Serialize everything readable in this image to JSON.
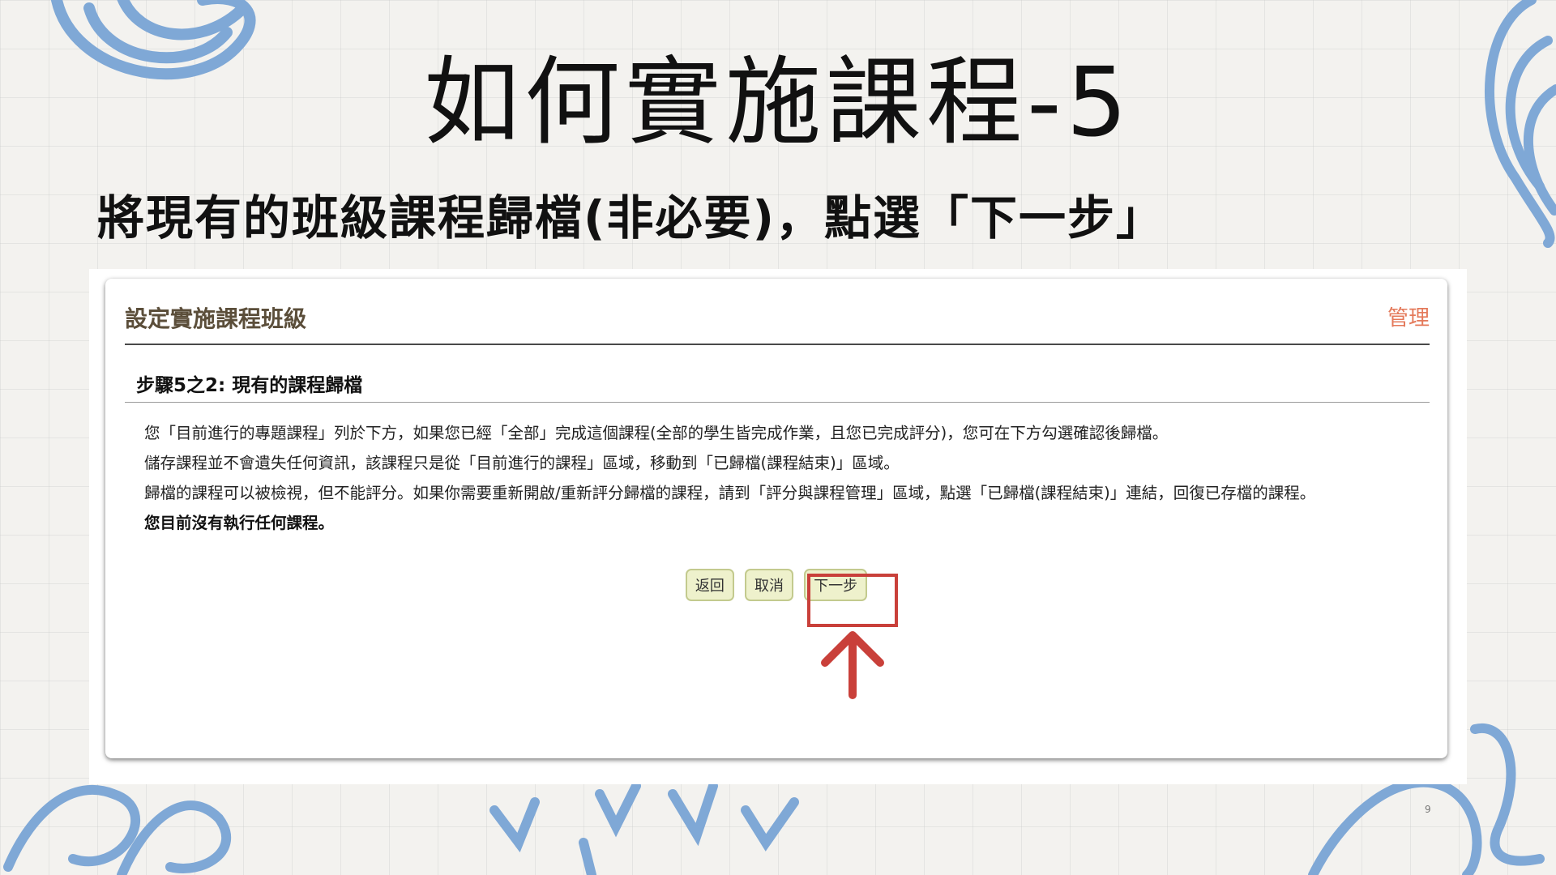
{
  "slide": {
    "title": "如何實施課程-5",
    "subtitle": "將現有的班級課程歸檔(非必要)，點選「下一步」",
    "page_number": "9"
  },
  "panel": {
    "title": "設定實施課程班級",
    "manage_link": "管理",
    "step_title": "步驟5之2: 現有的課程歸檔",
    "paragraphs": [
      "您「目前進行的專題課程」列於下方，如果您已經「全部」完成這個課程(全部的學生皆完成作業，且您已完成評分)，您可在下方勾選確認後歸檔。",
      "儲存課程並不會遺失任何資訊，該課程只是從「目前進行的課程」區域，移動到「已歸檔(課程結束)」區域。",
      "歸檔的課程可以被檢視，但不能評分。如果你需要重新開啟/重新評分歸檔的課程，請到「評分與課程管理」區域，點選「已歸檔(課程結束)」連結，回復已存檔的課程。"
    ],
    "no_course_notice": "您目前沒有執行任何課程。",
    "buttons": {
      "back": "返回",
      "cancel": "取消",
      "next": "下一步"
    }
  },
  "colors": {
    "highlight": "#c9403a",
    "manage_link": "#e4795a",
    "panel_title": "#5b4e3a",
    "button_bg": "#eef1cc",
    "decoration": "#7fa8d6"
  },
  "icons": {
    "arrow": "up-arrow-icon"
  }
}
